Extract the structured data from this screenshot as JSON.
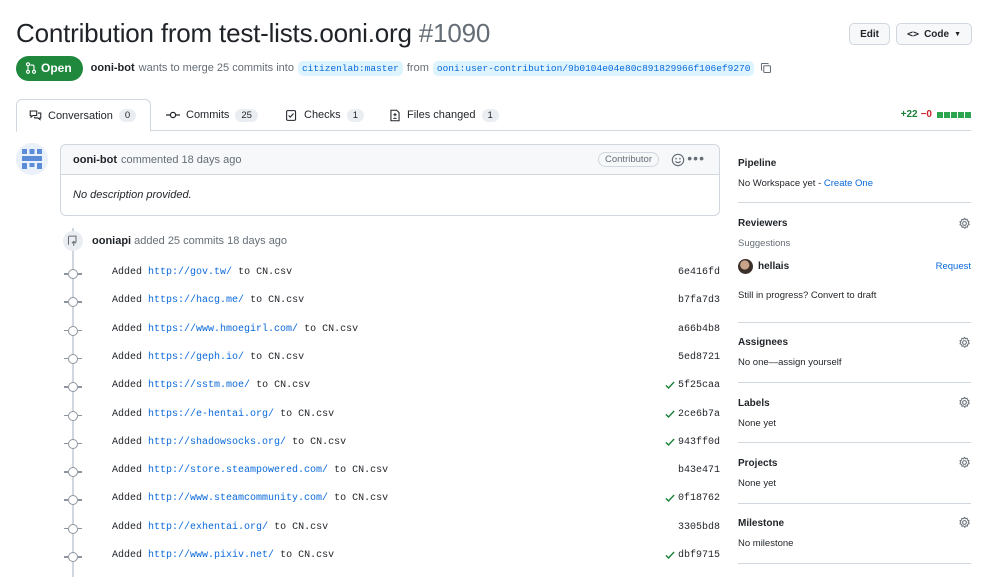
{
  "header": {
    "title": "Contribution from test-lists.ooni.org",
    "number": "#1090",
    "edit_label": "Edit",
    "code_label": "Code"
  },
  "meta": {
    "state": "Open",
    "author": "ooni-bot",
    "text_merge": "wants to merge 25 commits into",
    "base_branch": "citizenlab:master",
    "text_from": "from",
    "head_branch": "ooni:user-contribution/9b0104e04e80c891829966f106ef9270"
  },
  "tabs": [
    {
      "label": "Conversation",
      "count": "0"
    },
    {
      "label": "Commits",
      "count": "25"
    },
    {
      "label": "Checks",
      "count": "1"
    },
    {
      "label": "Files changed",
      "count": "1"
    }
  ],
  "diffstat": {
    "additions": "+22",
    "deletions": "−0"
  },
  "comment": {
    "author": "ooni-bot",
    "action": "commented 18 days ago",
    "role": "Contributor",
    "body": "No description provided."
  },
  "event": {
    "author": "ooniapi",
    "text": "added 25 commits 18 days ago"
  },
  "commits": [
    {
      "prefix": "Added",
      "url": "http://gov.tw/",
      "suffix": "to CN.csv",
      "sha": "6e416fd",
      "check": false
    },
    {
      "prefix": "Added",
      "url": "https://hacg.me/",
      "suffix": "to CN.csv",
      "sha": "b7fa7d3",
      "check": false
    },
    {
      "prefix": "Added",
      "url": "https://www.hmoegirl.com/",
      "suffix": "to CN.csv",
      "sha": "a66b4b8",
      "check": false
    },
    {
      "prefix": "Added",
      "url": "https://geph.io/",
      "suffix": "to CN.csv",
      "sha": "5ed8721",
      "check": false
    },
    {
      "prefix": "Added",
      "url": "https://sstm.moe/",
      "suffix": "to CN.csv",
      "sha": "5f25caa",
      "check": true
    },
    {
      "prefix": "Added",
      "url": "https://e-hentai.org/",
      "suffix": "to CN.csv",
      "sha": "2ce6b7a",
      "check": true
    },
    {
      "prefix": "Added",
      "url": "http://shadowsocks.org/",
      "suffix": "to CN.csv",
      "sha": "943ff0d",
      "check": true
    },
    {
      "prefix": "Added",
      "url": "http://store.steampowered.com/",
      "suffix": "to CN.csv",
      "sha": "b43e471",
      "check": false
    },
    {
      "prefix": "Added",
      "url": "http://www.steamcommunity.com/",
      "suffix": "to CN.csv",
      "sha": "0f18762",
      "check": true
    },
    {
      "prefix": "Added",
      "url": "http://exhentai.org/",
      "suffix": "to CN.csv",
      "sha": "3305bd8",
      "check": false
    },
    {
      "prefix": "Added",
      "url": "http://www.pixiv.net/",
      "suffix": "to CN.csv",
      "sha": "dbf9715",
      "check": true
    }
  ],
  "sidebar": {
    "pipeline": {
      "title": "Pipeline",
      "text": "No Workspace yet - ",
      "link": "Create One"
    },
    "reviewers": {
      "title": "Reviewers",
      "suggestions": "Suggestions",
      "reviewer": "hellais",
      "request": "Request",
      "draft": "Still in progress? Convert to draft"
    },
    "assignees": {
      "title": "Assignees",
      "text": "No one—assign yourself"
    },
    "labels": {
      "title": "Labels",
      "text": "None yet"
    },
    "projects": {
      "title": "Projects",
      "text": "None yet"
    },
    "milestone": {
      "title": "Milestone",
      "text": "No milestone"
    }
  },
  "colors": {
    "accent": "#0969da",
    "open": "#1f883d",
    "success": "#1a7f37",
    "danger": "#cf222e"
  }
}
